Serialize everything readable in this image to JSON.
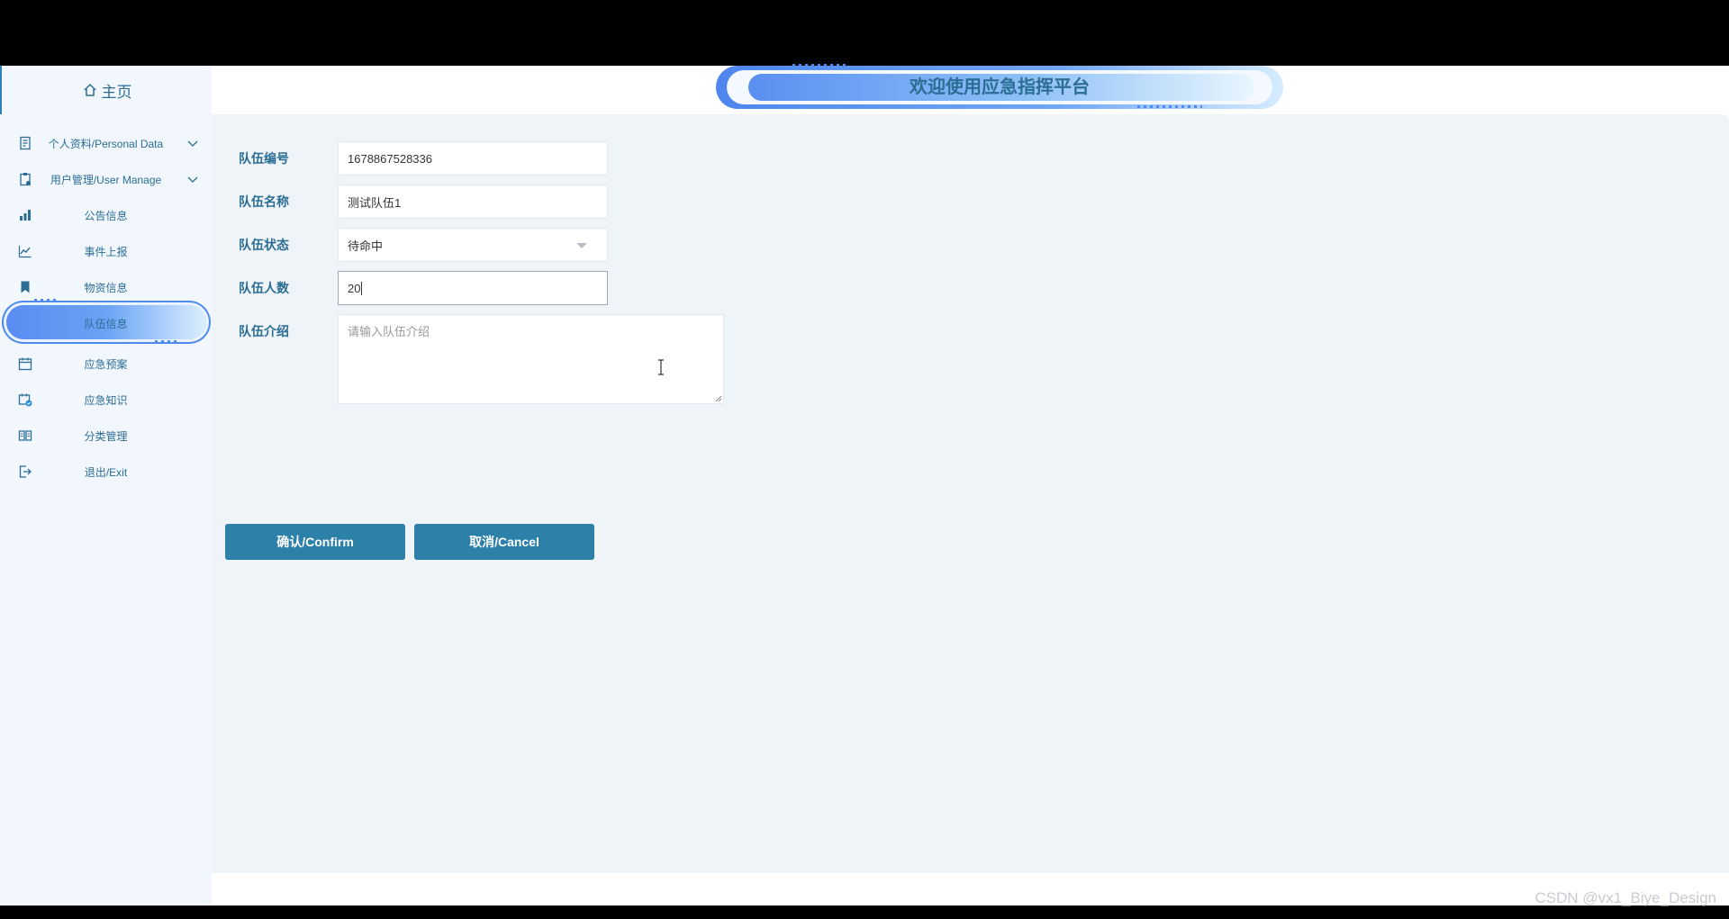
{
  "sidebar": {
    "home_label": "主页",
    "items": [
      {
        "label": "个人资料/Personal Data",
        "icon": "document-icon",
        "expandable": true
      },
      {
        "label": "用户管理/User Manage",
        "icon": "clipboard-icon",
        "expandable": true
      },
      {
        "label": "公告信息",
        "icon": "bar-chart-icon"
      },
      {
        "label": "事件上报",
        "icon": "line-chart-icon"
      },
      {
        "label": "物资信息",
        "icon": "bookmark-icon"
      },
      {
        "label": "队伍信息",
        "icon": "team-icon",
        "active": true
      },
      {
        "label": "应急预案",
        "icon": "calendar-icon"
      },
      {
        "label": "应急知识",
        "icon": "calendar-check-icon"
      },
      {
        "label": "分类管理",
        "icon": "book-icon"
      },
      {
        "label": "退出/Exit",
        "icon": "exit-icon"
      }
    ]
  },
  "header": {
    "title": "欢迎使用应急指挥平台"
  },
  "form": {
    "team_id": {
      "label": "队伍编号",
      "value": "1678867528336"
    },
    "team_name": {
      "label": "队伍名称",
      "value": "测试队伍1"
    },
    "team_status": {
      "label": "队伍状态",
      "value": "待命中"
    },
    "team_size": {
      "label": "队伍人数",
      "value": "20"
    },
    "team_intro": {
      "label": "队伍介绍",
      "placeholder": "请输入队伍介绍"
    }
  },
  "actions": {
    "confirm": "确认/Confirm",
    "cancel": "取消/Cancel"
  },
  "watermark": "CSDN @vx1_Biye_Design",
  "colors": {
    "accent": "#2d81a9",
    "text_primary": "#2b6d93",
    "sidebar_bg": "#f2f7fe",
    "content_bg": "#eff4f8"
  }
}
